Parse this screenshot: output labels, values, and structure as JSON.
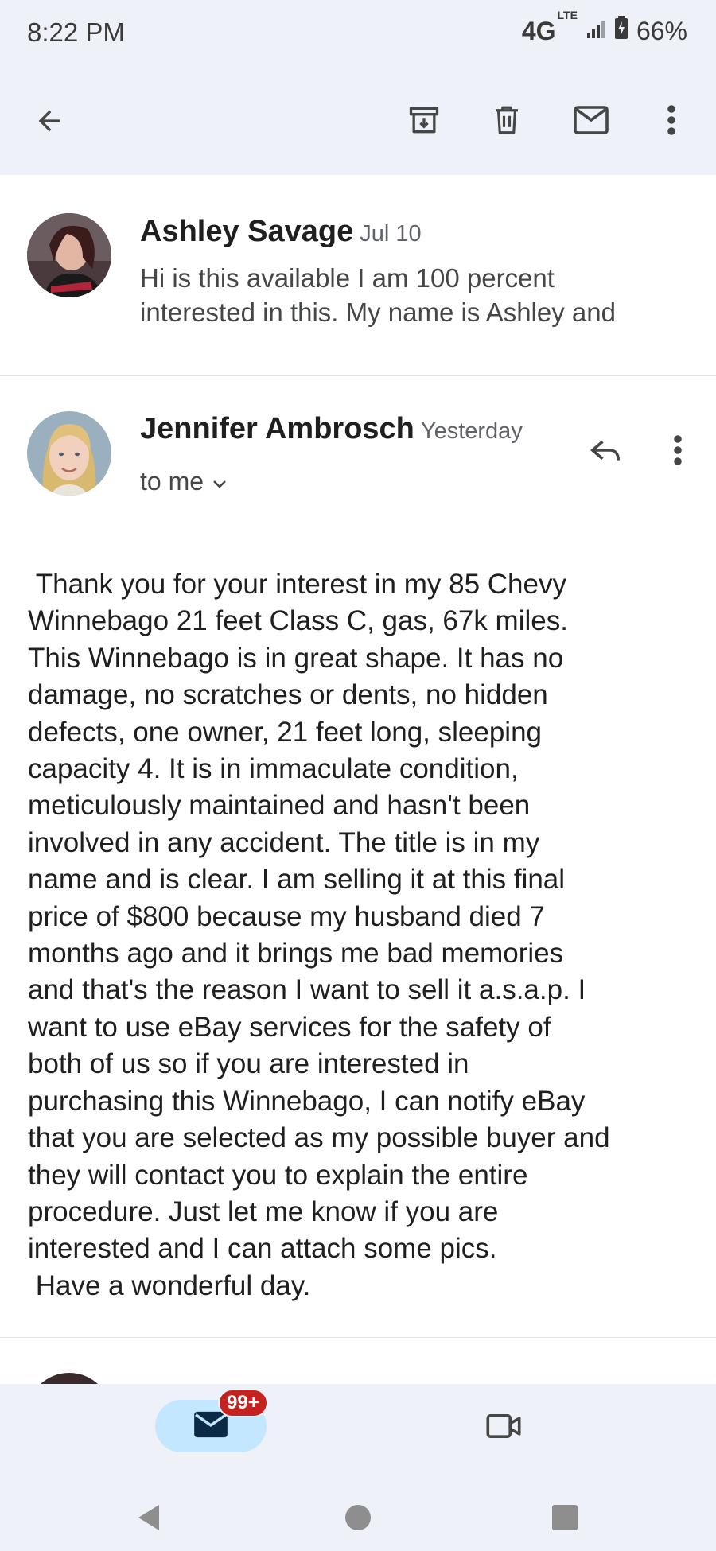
{
  "status_bar": {
    "time": "8:22 PM",
    "network": "4G",
    "network_sup": "LTE",
    "battery": "66%"
  },
  "app_bar": {
    "icons": [
      "back-arrow-icon",
      "archive-icon",
      "delete-icon",
      "mark-unread-icon",
      "more-vert-icon"
    ]
  },
  "emails": [
    {
      "sender": "Ashley Savage",
      "date": "Jul 10",
      "snippet_line1": "Hi is this available I am 100 percent",
      "snippet_line2": "interested in this. My name is Ashley and"
    },
    {
      "sender": "Jennifer Ambrosch",
      "date": "Yesterday",
      "recipient": "to me",
      "body": " Thank you for your interest in my 85 Chevy\nWinnebago 21 feet Class C, gas, 67k miles.\nThis Winnebago is in great shape. It has no\ndamage, no scratches or dents, no hidden\ndefects, one owner, 21 feet long, sleeping\ncapacity 4. It is in immaculate condition,\nmeticulously maintained and hasn't been\ninvolved in any accident. The title is in my\nname and is clear. I am selling it at this final\nprice of $800 because my husband died 7\nmonths ago and it brings me bad memories\nand that's the reason I want to sell it a.s.a.p. I\nwant to use eBay services for the safety of\nboth of us so if you are interested in\npurchasing this Winnebago, I can notify eBay\nthat you are selected as my possible buyer and\nthey will contact you to explain the entire\nprocedure. Just let me know if you are\ninterested and I can attach some pics.\n Have a wonderful day."
    }
  ],
  "bottom_nav": {
    "mail_badge": "99+",
    "items": [
      "mail-icon",
      "meet-video-icon"
    ]
  },
  "colors": {
    "chrome_bg": "#eef1f8",
    "active_pill": "#c3e7ff",
    "badge": "#c5221f"
  }
}
